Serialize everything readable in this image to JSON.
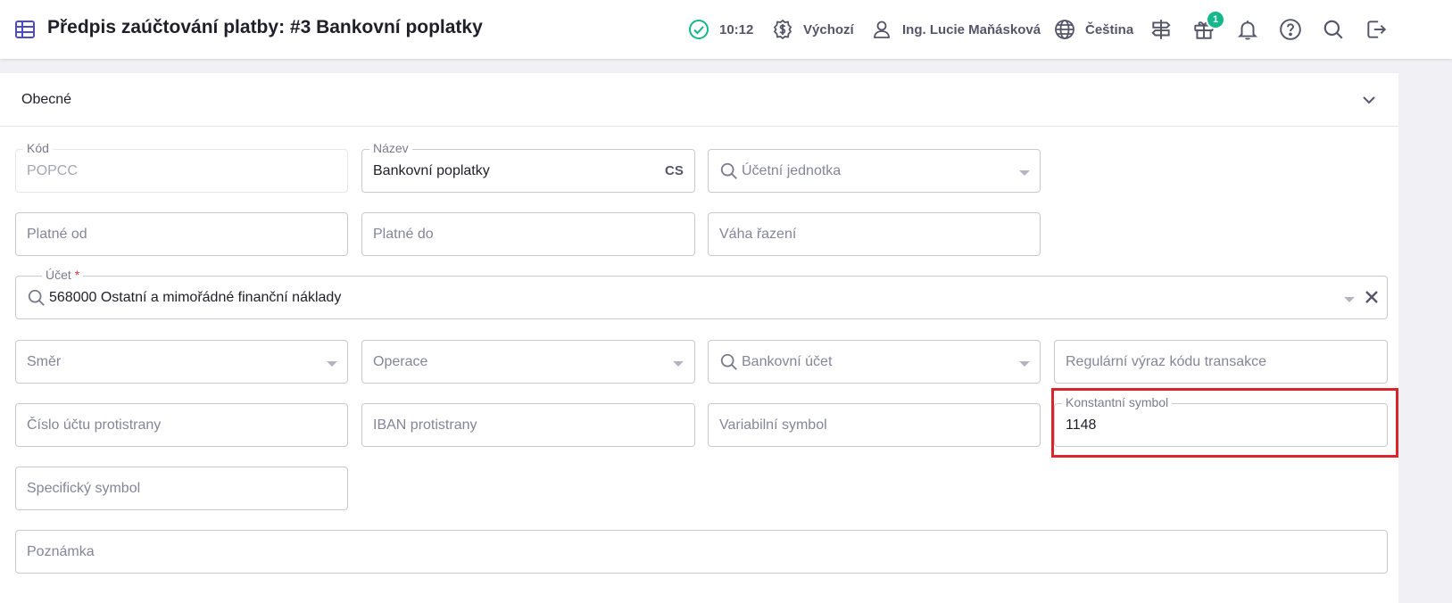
{
  "header": {
    "title": "Předpis zaúčtování platby: #3 Bankovní poplatky",
    "time": "10:12",
    "currency": "Výchozí",
    "user": "Ing. Lucie Maňásková",
    "language": "Čeština",
    "gift_badge": "1"
  },
  "section": {
    "title": "Obecné"
  },
  "form": {
    "kod": {
      "label": "Kód",
      "value": "POPCC"
    },
    "nazev": {
      "label": "Název",
      "value": "Bankovní poplatky",
      "lang": "CS"
    },
    "ucetni_jednotka": {
      "placeholder": "Účetní jednotka"
    },
    "platne_od": {
      "placeholder": "Platné od"
    },
    "platne_do": {
      "placeholder": "Platné do"
    },
    "vaha_razeni": {
      "placeholder": "Váha řazení"
    },
    "ucet": {
      "label": "Účet",
      "required_mark": "*",
      "value": "568000 Ostatní a mimořádné finanční náklady"
    },
    "smer": {
      "placeholder": "Směr"
    },
    "operace": {
      "placeholder": "Operace"
    },
    "bankovni_ucet": {
      "placeholder": "Bankovní účet"
    },
    "regularni_vyraz": {
      "placeholder": "Regulární výraz kódu transakce"
    },
    "cislo_uctu_protistrany": {
      "placeholder": "Číslo účtu protistrany"
    },
    "iban_protistrany": {
      "placeholder": "IBAN protistrany"
    },
    "variabilni_symbol": {
      "placeholder": "Variabilní symbol"
    },
    "konstantni_symbol": {
      "label": "Konstantní symbol",
      "value": "1148"
    },
    "specificky_symbol": {
      "placeholder": "Specifický symbol"
    },
    "poznamka": {
      "placeholder": "Poznámka"
    }
  },
  "colors": {
    "accent": "#4b4bc8",
    "success": "#14b88a",
    "highlight": "#d8262b"
  }
}
